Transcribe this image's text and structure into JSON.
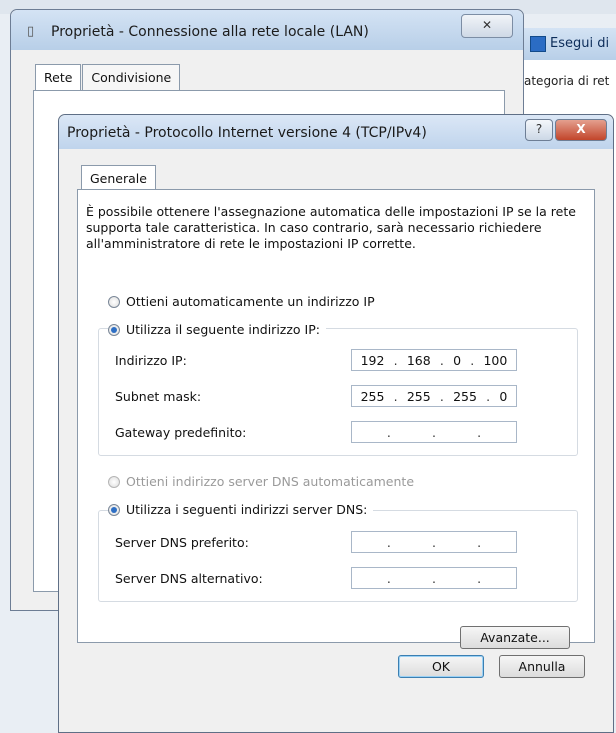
{
  "lan_window": {
    "title": "Proprietà - Connessione alla rete locale (LAN)",
    "close": "✕",
    "tabs": [
      "Rete",
      "Condivisione"
    ]
  },
  "right_window": {
    "title": "Esegui di",
    "text": "ategoria di ret"
  },
  "ipv4_dialog": {
    "title": "Proprietà - Protocollo Internet versione 4 (TCP/IPv4)",
    "help": "?",
    "close": "X",
    "tab": "Generale",
    "description": "È possibile ottenere l'assegnazione automatica delle impostazioni IP se la rete supporta tale caratteristica. In caso contrario, sarà necessario richiedere all'amministratore di rete le impostazioni IP corrette.",
    "ip_auto_label": "Ottieni automaticamente un indirizzo IP",
    "ip_manual_label": "Utilizza il seguente indirizzo IP:",
    "ip_fields": [
      {
        "label": "Indirizzo IP:",
        "octets": [
          "192",
          "168",
          "0",
          "100"
        ]
      },
      {
        "label": "Subnet mask:",
        "octets": [
          "255",
          "255",
          "255",
          "0"
        ]
      },
      {
        "label": "Gateway predefinito:",
        "octets": [
          "",
          "",
          "",
          ""
        ]
      }
    ],
    "dns_auto_label": "Ottieni indirizzo server DNS automaticamente",
    "dns_manual_label": "Utilizza i seguenti indirizzi server DNS:",
    "dns_fields": [
      {
        "label": "Server DNS preferito:",
        "octets": [
          "",
          "",
          "",
          ""
        ]
      },
      {
        "label": "Server DNS alternativo:",
        "octets": [
          "",
          "",
          "",
          ""
        ]
      }
    ],
    "advanced_button": "Avanzate...",
    "ok_button": "OK",
    "cancel_button": "Annulla"
  }
}
